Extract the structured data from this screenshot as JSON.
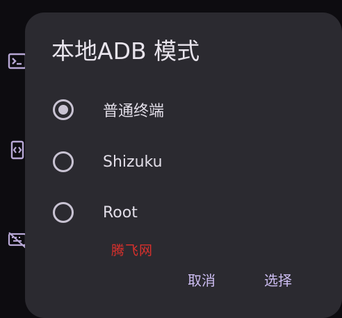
{
  "background": {
    "icons": [
      "terminal-icon",
      "code-brackets-icon",
      "keyboard-off-icon"
    ]
  },
  "dialog": {
    "title": "本地ADB 模式",
    "options": [
      {
        "label": "普通终端",
        "selected": true
      },
      {
        "label": "Shizuku",
        "selected": false
      },
      {
        "label": "Root",
        "selected": false
      }
    ],
    "watermark": "腾飞网",
    "cancel_label": "取消",
    "confirm_label": "选择"
  },
  "colors": {
    "surface": "#2b2a30",
    "backdrop": "#0d0c10",
    "accent": "#cdbdf2",
    "radio": "#c9c3d3",
    "watermark": "#d9302c"
  }
}
